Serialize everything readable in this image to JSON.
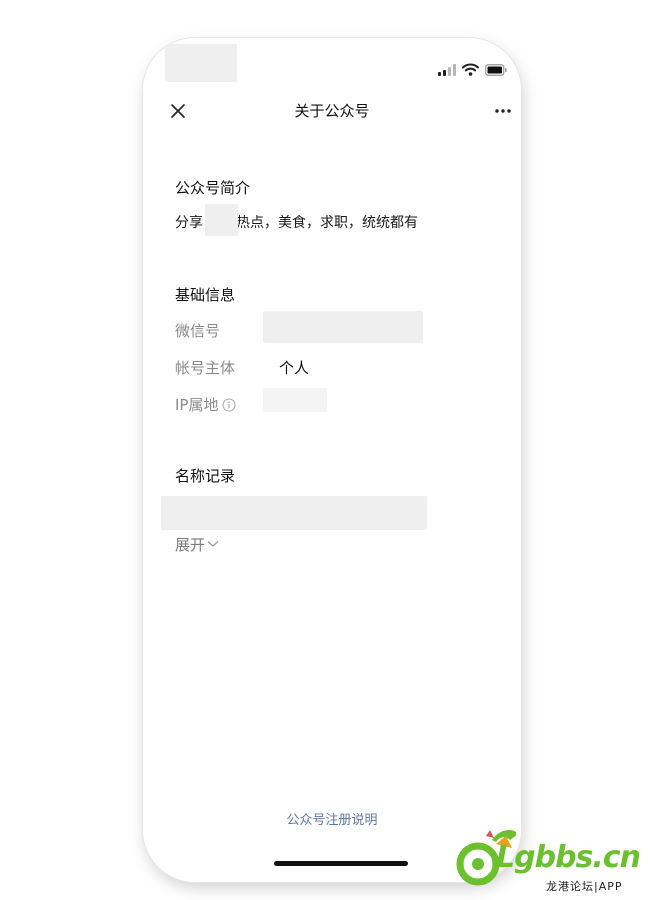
{
  "nav": {
    "title": "关于公众号"
  },
  "intro": {
    "heading": "公众号简介",
    "text_before": "分享",
    "text_after": "热点，美食，求职，统统都有"
  },
  "basic_info": {
    "heading": "基础信息",
    "wechat_id_label": "微信号",
    "account_subject_label": "帐号主体",
    "account_subject_value": "个人",
    "ip_location_label": "IP属地"
  },
  "name_history": {
    "heading": "名称记录",
    "expand_label": "展开"
  },
  "footer": {
    "registration_link": "公众号注册说明"
  },
  "watermark": {
    "brand": "Lgbbs.cn",
    "subtitle": "龙港论坛|APP"
  },
  "icons": {
    "close": "close-icon",
    "more": "more-icon",
    "info": "info-circle-icon",
    "expand": "chevron-down-icon",
    "signal": "signal-icon",
    "wifi": "wifi-icon",
    "battery": "battery-icon"
  },
  "colors": {
    "link": "#5f77a3",
    "label": "#8a8a8a",
    "brand_green": "#6cbf2e"
  }
}
